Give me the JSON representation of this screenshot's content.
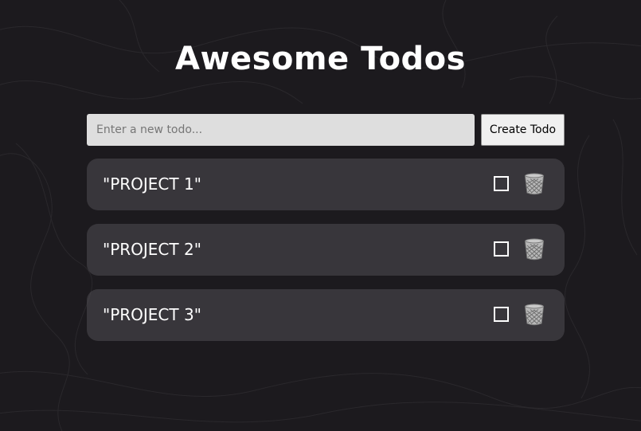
{
  "app": {
    "title": "Awesome Todos"
  },
  "form": {
    "placeholder": "Enter a new todo...",
    "value": "",
    "create_label": "Create Todo"
  },
  "todos": [
    {
      "text": "\"PROJECT 1\"",
      "completed": false,
      "delete_icon": "wastebasket-icon"
    },
    {
      "text": "\"PROJECT 2\"",
      "completed": false,
      "delete_icon": "wastebasket-icon"
    },
    {
      "text": "\"PROJECT 3\"",
      "completed": false,
      "delete_icon": "wastebasket-icon"
    }
  ],
  "colors": {
    "background": "#1c1a1e",
    "card": "#3a383d",
    "text": "#ffffff",
    "input_background": "#dedede"
  }
}
